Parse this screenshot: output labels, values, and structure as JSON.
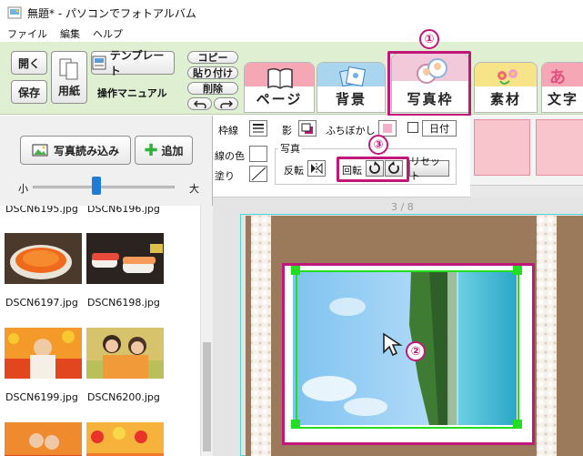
{
  "titlebar": {
    "title": "無題* - パソコンでフォトアルバム"
  },
  "menu": {
    "items": [
      "ファイル",
      "編集",
      "ヘルプ"
    ]
  },
  "toolbar": {
    "open": "開く",
    "save": "保存",
    "paper": "用紙",
    "template": "テンプレート",
    "manual": "操作マニュアル",
    "copy": "コピー",
    "paste": "貼り付け",
    "delete": "削除",
    "undo_icon": "undo-icon",
    "redo_icon": "redo-icon"
  },
  "tabs": [
    {
      "label": "ページ",
      "color": "#f6a7b5"
    },
    {
      "label": "背景",
      "color": "#a9d5ee"
    },
    {
      "label": "写真枠",
      "color": "#f2c9d9"
    },
    {
      "label": "素材",
      "color": "#f8e488"
    },
    {
      "label": "文字",
      "color": "#f6a7b5"
    }
  ],
  "left": {
    "load_photos": "写真読み込み",
    "add": "追加",
    "size_small": "小",
    "size_large": "大",
    "size_level": 0.45
  },
  "thumbs": [
    {
      "name": "DSCN6195.jpg"
    },
    {
      "name": "DSCN6196.jpg"
    },
    {
      "name": "DSCN6197.jpg"
    },
    {
      "name": "DSCN6198.jpg"
    },
    {
      "name": "DSCN6199.jpg"
    },
    {
      "name": "DSCN6200.jpg"
    }
  ],
  "props": {
    "frame_line": "枠線",
    "shadow": "影",
    "blur_edge": "ふちぼかし",
    "date": "日付",
    "line_color": "線の色",
    "fill": "塗り",
    "photo_group": "写真",
    "flip": "反転",
    "rotate": "回転",
    "reset": "リセット"
  },
  "canvas": {
    "page_indicator": "3 / 8"
  },
  "annotations": {
    "one": "①",
    "two": "②",
    "three": "③"
  },
  "colors": {
    "accent": "#c0177a",
    "toolbar_bg": "#dff0d2",
    "selection": "#22dd22"
  }
}
